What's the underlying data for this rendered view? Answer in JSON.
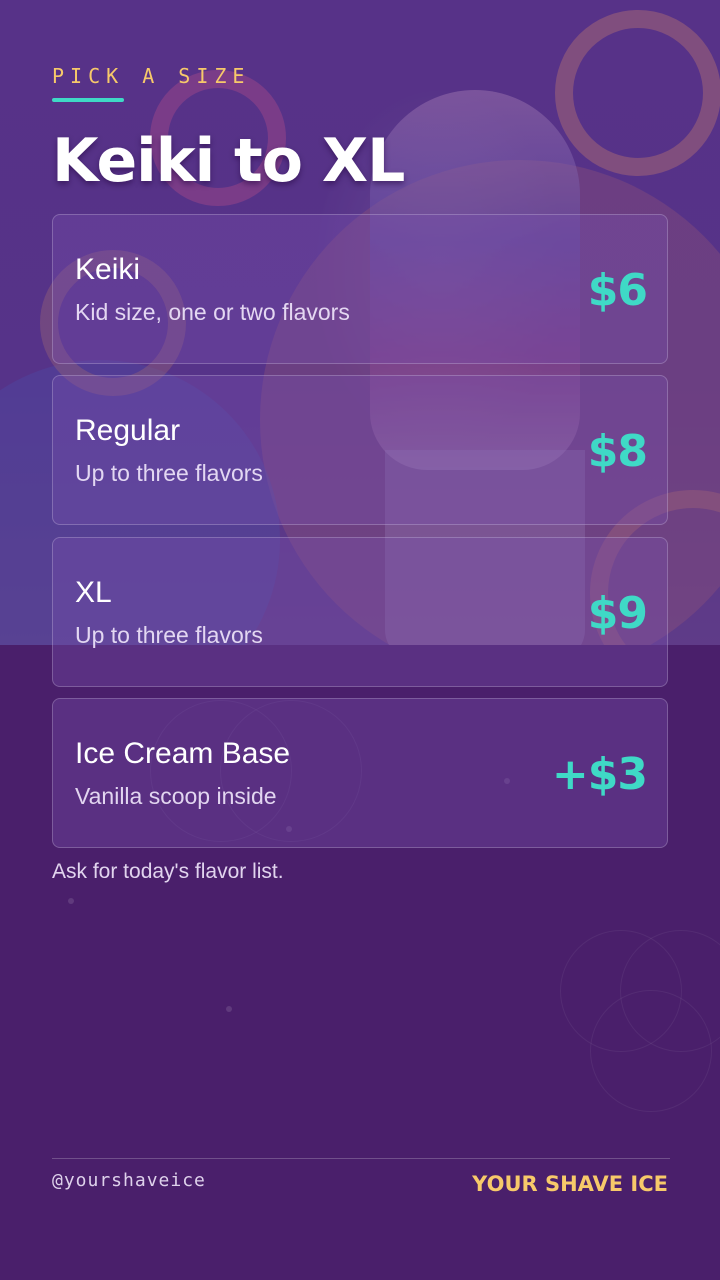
{
  "header": {
    "kicker": "PICK A SIZE",
    "title": "Keiki to XL"
  },
  "menu": [
    {
      "name": "Keiki",
      "desc": "Kid size, one or two flavors",
      "price": "$6"
    },
    {
      "name": "Regular",
      "desc": "Up to three flavors",
      "price": "$8"
    },
    {
      "name": "XL",
      "desc": "Up to three flavors",
      "price": "$9"
    },
    {
      "name": "Ice Cream Base",
      "desc": "Vanilla scoop inside",
      "price": "+$3"
    }
  ],
  "note": "Ask for today's flavor list.",
  "footer": {
    "handle": "@yourshaveice",
    "brand": "YOUR SHAVE ICE"
  },
  "colors": {
    "background": "#4a1f6b",
    "accent_teal": "#3fd9c6",
    "accent_gold": "#f7c96a"
  }
}
